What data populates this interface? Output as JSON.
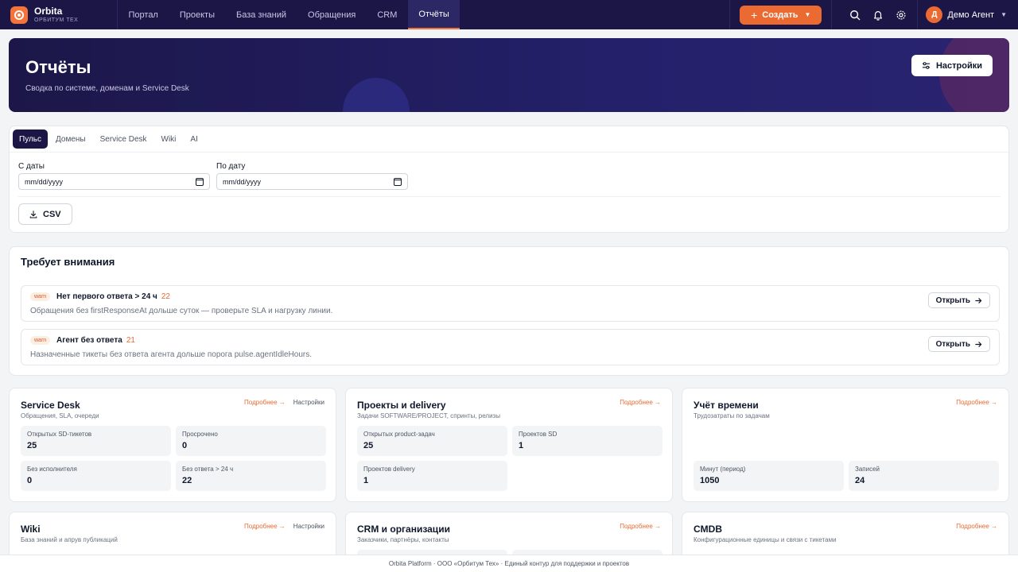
{
  "brand": {
    "name": "Orbita",
    "sub": "ОРБИТУМ ТЕХ"
  },
  "nav": [
    {
      "label": "Портал"
    },
    {
      "label": "Проекты"
    },
    {
      "label": "База знаний"
    },
    {
      "label": "Обращения"
    },
    {
      "label": "CRM"
    },
    {
      "label": "Отчёты"
    }
  ],
  "topbar": {
    "create_label": "Создать",
    "user_initial": "Д",
    "user_name": "Демо Агент"
  },
  "hero": {
    "title": "Отчёты",
    "subtitle": "Сводка по системе, доменам и Service Desk",
    "settings_label": "Настройки"
  },
  "tabs": [
    {
      "label": "Пульс"
    },
    {
      "label": "Домены"
    },
    {
      "label": "Service Desk"
    },
    {
      "label": "Wiki"
    },
    {
      "label": "AI"
    }
  ],
  "filters": {
    "from_label": "С даты",
    "to_label": "По дату",
    "from_placeholder": "mm/dd/yyyy",
    "to_placeholder": "mm/dd/yyyy",
    "csv_label": "CSV"
  },
  "attention": {
    "title": "Требует внимания",
    "items": [
      {
        "badge": "warn",
        "title": "Нет первого ответа > 24 ч",
        "count": "22",
        "desc": "Обращения без firstResponseAt дольше суток — проверьте SLA и нагрузку линии.",
        "button": "Открыть"
      },
      {
        "badge": "warn",
        "title": "Агент без ответа",
        "count": "21",
        "desc": "Назначенные тикеты без ответа агента дольше порога pulse.agentIdleHours.",
        "button": "Открыть"
      }
    ]
  },
  "cards": {
    "more_label": "Подробнее →",
    "settings_label": "Настройки",
    "service_desk": {
      "title": "Service Desk",
      "sub": "Обращения, SLA, очереди",
      "stats": [
        {
          "label": "Открытых SD-тикетов",
          "value": "25"
        },
        {
          "label": "Просрочено",
          "value": "0"
        },
        {
          "label": "Без исполнителя",
          "value": "0"
        },
        {
          "label": "Без ответа > 24 ч",
          "value": "22"
        }
      ]
    },
    "projects": {
      "title": "Проекты и delivery",
      "sub": "Задачи SOFTWARE/PROJECT, спринты, релизы",
      "stats": [
        {
          "label": "Открытых product-задач",
          "value": "25"
        },
        {
          "label": "Проектов SD",
          "value": "1"
        },
        {
          "label": "Проектов delivery",
          "value": "1"
        }
      ]
    },
    "time": {
      "title": "Учёт времени",
      "sub": "Трудозатраты по задачам",
      "stats": [
        {
          "label": "Минут (период)",
          "value": "1050"
        },
        {
          "label": "Записей",
          "value": "24"
        }
      ]
    },
    "wiki": {
      "title": "Wiki",
      "sub": "База знаний и апрув публикаций"
    },
    "crm": {
      "title": "CRM и организации",
      "sub": "Заказчики, партнёры, контакты"
    },
    "cmdb": {
      "title": "CMDB",
      "sub": "Конфигурационные единицы и связи с тикетами"
    }
  },
  "footer": {
    "text": "Orbita Platform · ООО «Орбитум Тех» · Единый контур для поддержки и проектов"
  },
  "colors": {
    "navy": "#1b1646",
    "accent": "#ea6a31"
  }
}
